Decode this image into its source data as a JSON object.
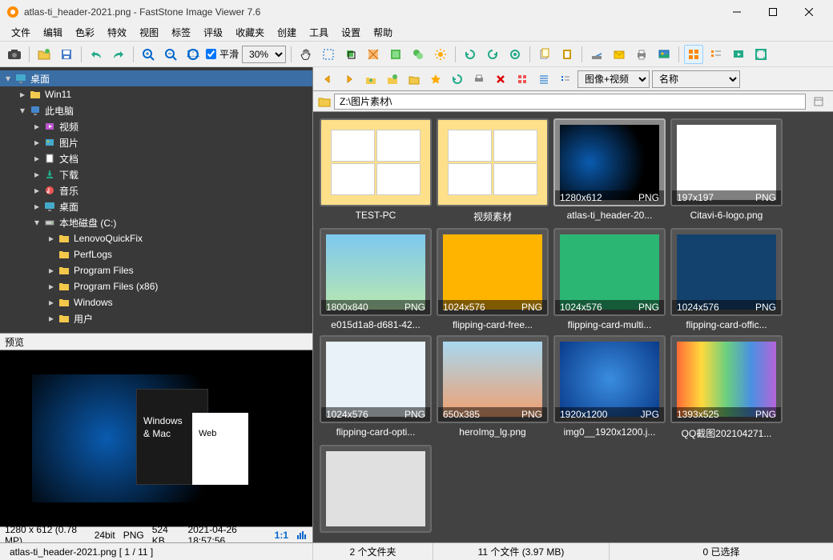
{
  "window": {
    "title": "atlas-ti_header-2021.png   -   FastStone Image Viewer 7.6"
  },
  "menu": [
    "文件",
    "编辑",
    "色彩",
    "特效",
    "视图",
    "标签",
    "评级",
    "收藏夹",
    "创建",
    "工具",
    "设置",
    "帮助"
  ],
  "toolbar": {
    "smooth": "平滑",
    "zoom": "30%"
  },
  "tree": {
    "root": "桌面",
    "items": [
      {
        "depth": 0,
        "exp": "-",
        "icon": "desktop",
        "label": "桌面",
        "sel": true
      },
      {
        "depth": 1,
        "exp": "+",
        "icon": "folder",
        "label": "Win11"
      },
      {
        "depth": 1,
        "exp": "-",
        "icon": "pc",
        "label": "此电脑"
      },
      {
        "depth": 2,
        "exp": "+",
        "icon": "video",
        "label": "视频"
      },
      {
        "depth": 2,
        "exp": "+",
        "icon": "image",
        "label": "图片"
      },
      {
        "depth": 2,
        "exp": "+",
        "icon": "doc",
        "label": "文档"
      },
      {
        "depth": 2,
        "exp": "+",
        "icon": "download",
        "label": "下载"
      },
      {
        "depth": 2,
        "exp": "+",
        "icon": "music",
        "label": "音乐"
      },
      {
        "depth": 2,
        "exp": "+",
        "icon": "desktop",
        "label": "桌面"
      },
      {
        "depth": 2,
        "exp": "-",
        "icon": "drive",
        "label": "本地磁盘 (C:)"
      },
      {
        "depth": 3,
        "exp": "+",
        "icon": "folder",
        "label": "LenovoQuickFix"
      },
      {
        "depth": 3,
        "exp": "",
        "icon": "folder",
        "label": "PerfLogs"
      },
      {
        "depth": 3,
        "exp": "+",
        "icon": "folder",
        "label": "Program Files"
      },
      {
        "depth": 3,
        "exp": "+",
        "icon": "folder",
        "label": "Program Files (x86)"
      },
      {
        "depth": 3,
        "exp": "+",
        "icon": "folder",
        "label": "Windows"
      },
      {
        "depth": 3,
        "exp": "+",
        "icon": "folder",
        "label": "用户"
      }
    ]
  },
  "preview": {
    "header": "预览",
    "box1_text1": "Windows",
    "box1_text2": "& Mac",
    "box2_text": "Web",
    "dims": "1280 x 612 (0.78 MP)",
    "depth": "24bit",
    "fmt": "PNG",
    "size": "524 KB",
    "date": "2021-04-26  18:57:56",
    "ratio": "1:1"
  },
  "nav": {
    "filter": "图像+视频",
    "sort": "名称",
    "path": "Z:\\图片素材\\"
  },
  "thumbs": [
    {
      "type": "folder",
      "label": "TEST-PC"
    },
    {
      "type": "folder",
      "label": "视频素材"
    },
    {
      "type": "img",
      "dims": "1280x612",
      "fmt": "PNG",
      "label": "atlas-ti_header-20...",
      "sel": true,
      "bg": "radial-gradient(circle at 30% 50%,#0a5bb0,#000 70%)"
    },
    {
      "type": "img",
      "dims": "197x197",
      "fmt": "PNG",
      "label": "Citavi-6-logo.png",
      "bg": "#fff"
    },
    {
      "type": "img",
      "dims": "1800x840",
      "fmt": "PNG",
      "label": "e015d1a8-d681-42...",
      "bg": "linear-gradient(#7ec8f0,#b8e8b0)"
    },
    {
      "type": "img",
      "dims": "1024x576",
      "fmt": "PNG",
      "label": "flipping-card-free...",
      "bg": "#ffb400"
    },
    {
      "type": "img",
      "dims": "1024x576",
      "fmt": "PNG",
      "label": "flipping-card-multi...",
      "bg": "#2bb673"
    },
    {
      "type": "img",
      "dims": "1024x576",
      "fmt": "PNG",
      "label": "flipping-card-offic...",
      "bg": "#14426f"
    },
    {
      "type": "img",
      "dims": "1024x576",
      "fmt": "PNG",
      "label": "flipping-card-opti...",
      "bg": "#e8f2f8"
    },
    {
      "type": "img",
      "dims": "650x385",
      "fmt": "PNG",
      "label": "heroImg_lg.png",
      "bg": "linear-gradient(#a8d8f0,#f0a070)"
    },
    {
      "type": "img",
      "dims": "1920x1200",
      "fmt": "JPG",
      "label": "img0__1920x1200.j...",
      "bg": "radial-gradient(circle,#3a8de0,#0a3a8a)"
    },
    {
      "type": "img",
      "dims": "1393x525",
      "fmt": "PNG",
      "label": "QQ截图202104271...",
      "bg": "linear-gradient(90deg,#ff6b35,#ffd93d,#6bcf7f,#4a90e2,#b565d8)"
    },
    {
      "type": "img",
      "dims": "",
      "fmt": "",
      "label": "",
      "bg": "#e0e0e0"
    }
  ],
  "status": {
    "file": "atlas-ti_header-2021.png [ 1 / 11 ]",
    "folders": "2 个文件夹",
    "files": "11 个文件 (3.97 MB)",
    "selected": "0 已选择"
  },
  "colors": {
    "folder": "#f2c94c"
  }
}
